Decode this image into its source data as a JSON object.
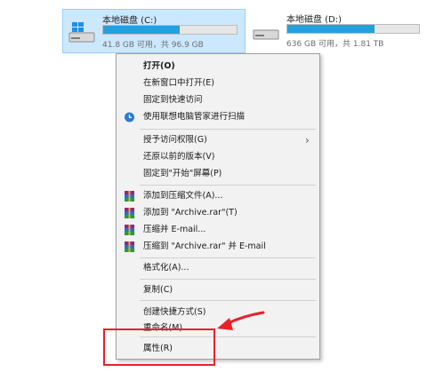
{
  "drives": [
    {
      "name": "本地磁盘 (C:)",
      "info": "41.8 GB 可用，共 96.9 GB",
      "fill_fraction": 0.57,
      "selected": true
    },
    {
      "name": "本地磁盘 (D:)",
      "info": "636 GB 可用，共 1.81 TB",
      "fill_fraction": 0.66,
      "selected": false
    }
  ],
  "menu": {
    "open": "打开(O)",
    "open_new_window": "在新窗口中打开(E)",
    "pin_quick_access": "固定到快速访问",
    "scan": "使用联想电脑管家进行扫描",
    "give_access": "授予访问权限(G)",
    "restore_versions": "还原以前的版本(V)",
    "pin_start": "固定到\"开始\"屏幕(P)",
    "add_archive": "添加到压缩文件(A)...",
    "add_archive_rar": "添加到 \"Archive.rar\"(T)",
    "compress_email": "压缩并 E-mail...",
    "compress_rar_email": "压缩到 \"Archive.rar\" 并 E-mail",
    "format": "格式化(A)...",
    "copy": "复制(C)",
    "create_shortcut": "创建快捷方式(S)",
    "rename": "重命名(M)",
    "properties": "属性(R)"
  },
  "colors": {
    "selection_bg": "#cce8ff",
    "drive_bar_fill": "#26a0da",
    "annotation": "#e8202a"
  }
}
